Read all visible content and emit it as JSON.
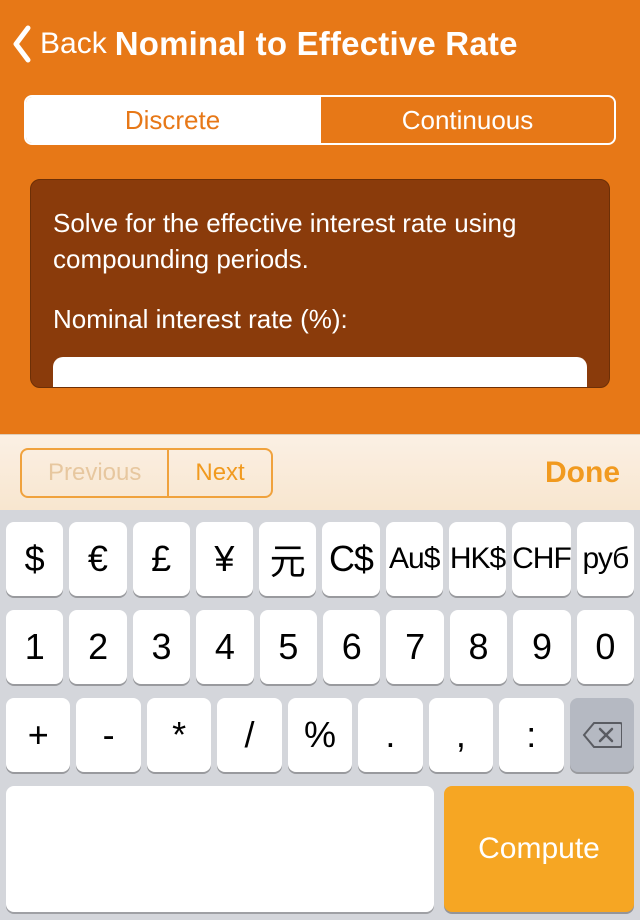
{
  "navbar": {
    "back_label": "Back",
    "title": "Nominal to Effective Rate"
  },
  "segments": {
    "discrete": "Discrete",
    "continuous": "Continuous"
  },
  "card": {
    "description": "Solve for the effective interest rate using compounding periods.",
    "nominal_label": "Nominal interest rate (%):"
  },
  "accessory": {
    "previous": "Previous",
    "next": "Next",
    "done": "Done"
  },
  "keyboard": {
    "row1": [
      "$",
      "€",
      "£",
      "¥",
      "元",
      "C$",
      "Au$",
      "HK$",
      "CHF",
      "руб"
    ],
    "row2": [
      "1",
      "2",
      "3",
      "4",
      "5",
      "6",
      "7",
      "8",
      "9",
      "0"
    ],
    "row3": [
      "+",
      "-",
      "*",
      "/",
      "%",
      ".",
      ",",
      ":"
    ],
    "compute": "Compute"
  }
}
